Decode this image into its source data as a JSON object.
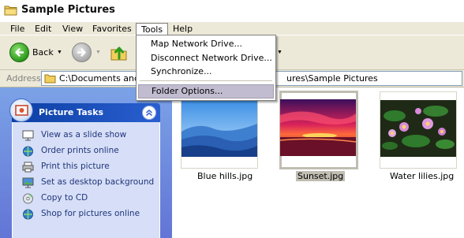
{
  "window": {
    "title": "Sample Pictures",
    "title_icon": "folder-icon"
  },
  "menubar": {
    "items": [
      {
        "label": "File"
      },
      {
        "label": "Edit"
      },
      {
        "label": "View"
      },
      {
        "label": "Favorites"
      },
      {
        "label": "Tools",
        "active": true
      },
      {
        "label": "Help"
      }
    ]
  },
  "toolbar": {
    "back_label": "Back",
    "back_icon": "back-arrow-icon",
    "forward_icon": "forward-arrow-icon",
    "up_icon": "folder-up-icon",
    "views_icon": "views-icon"
  },
  "address": {
    "label": "Address",
    "value_head": "C:\\Documents and S",
    "value_tail": "ures\\Sample Pictures"
  },
  "tools_menu": {
    "items": [
      {
        "label": "Map Network Drive..."
      },
      {
        "label": "Disconnect Network Drive..."
      },
      {
        "label": "Synchronize..."
      },
      {
        "label": "Folder Options...",
        "highlighted": true
      }
    ]
  },
  "task_pane": {
    "title": "Picture Tasks",
    "items": [
      {
        "label": "View as a slide show",
        "icon": "slideshow-icon"
      },
      {
        "label": "Order prints online",
        "icon": "order-prints-icon"
      },
      {
        "label": "Print this picture",
        "icon": "printer-icon"
      },
      {
        "label": "Set as desktop background",
        "icon": "desktop-background-icon"
      },
      {
        "label": "Copy to CD",
        "icon": "cd-icon"
      },
      {
        "label": "Shop for pictures online",
        "icon": "shop-online-icon"
      }
    ]
  },
  "thumbnails": [
    {
      "label": "Blue hills.jpg",
      "selected": false
    },
    {
      "label": "Sunset.jpg",
      "selected": true
    },
    {
      "label": "Water lilies.jpg",
      "selected": false
    }
  ],
  "colors": {
    "menubar_bg": "#ece9d8",
    "task_pane_header": "#0c3fa4",
    "task_link": "#21347a",
    "menu_highlight": "#c1bccf",
    "selection": "#c0bdb2"
  }
}
